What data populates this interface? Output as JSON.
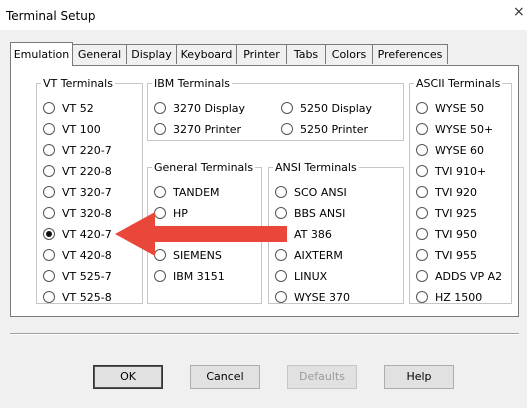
{
  "window": {
    "title": "Terminal Setup",
    "close_glyph": "×"
  },
  "tabs": [
    {
      "label": "Emulation",
      "active": true
    },
    {
      "label": "General"
    },
    {
      "label": "Display"
    },
    {
      "label": "Keyboard"
    },
    {
      "label": "Printer"
    },
    {
      "label": "Tabs"
    },
    {
      "label": "Colors"
    },
    {
      "label": "Preferences"
    }
  ],
  "groups": {
    "vt": {
      "legend": "VT Terminals",
      "options": [
        "VT 52",
        "VT 100",
        "VT 220-7",
        "VT 220-8",
        "VT 320-7",
        "VT 320-8",
        "VT 420-7",
        "VT 420-8",
        "VT 525-7",
        "VT 525-8"
      ],
      "selected": "VT 420-7"
    },
    "ibm": {
      "legend": "IBM Terminals",
      "options": [
        "3270 Display",
        "5250 Display",
        "3270 Printer",
        "5250 Printer"
      ]
    },
    "general": {
      "legend": "General Terminals",
      "options": [
        "TANDEM",
        "HP",
        "SIEMENS",
        "IBM 3151"
      ]
    },
    "ansi": {
      "legend": "ANSI Terminals",
      "options": [
        "SCO ANSI",
        "BBS ANSI",
        "AT 386",
        "AIXTERM",
        "LINUX",
        "WYSE 370"
      ]
    },
    "ascii": {
      "legend": "ASCII Terminals",
      "options": [
        "WYSE 50",
        "WYSE 50+",
        "WYSE 60",
        "TVI 910+",
        "TVI 920",
        "TVI 925",
        "TVI 950",
        "TVI 955",
        "ADDS VP A2",
        "HZ 1500"
      ]
    }
  },
  "buttons": {
    "ok": "OK",
    "cancel": "Cancel",
    "defaults": "Defaults",
    "help": "Help"
  },
  "colors": {
    "annotation_arrow": "#e8473a"
  }
}
